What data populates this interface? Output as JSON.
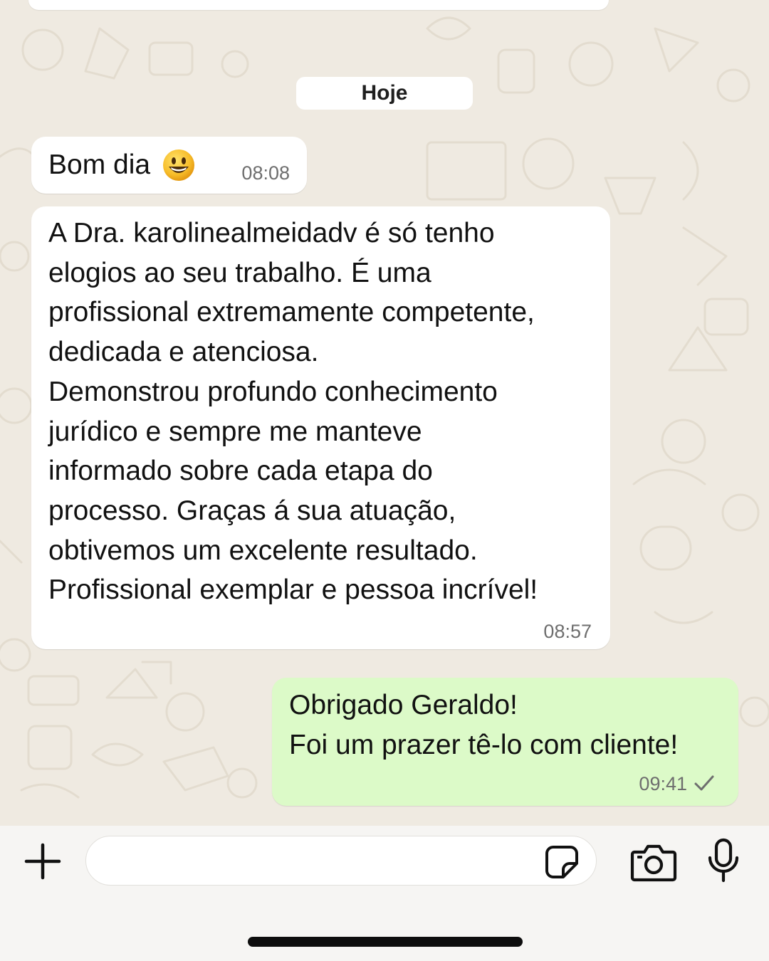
{
  "chat": {
    "date_separator": "Hoje",
    "messages": [
      {
        "direction": "incoming",
        "text": "Bom dia",
        "emoji": "smiling-face-emoji",
        "time": "08:08"
      },
      {
        "direction": "incoming",
        "text": "A Dra. karolinealmeidadv é só tenho\nelogios ao seu trabalho. É uma\nprofissional extremamente competente,\ndedicada e atenciosa.\nDemonstrou profundo conhecimento\njurídico e sempre me manteve\ninformado sobre cada etapa do\nprocesso. Graças á sua atuação,\nobtivemos um excelente resultado.\nProfissional exemplar e pessoa incrível!",
        "time": "08:57"
      },
      {
        "direction": "outgoing",
        "text": "Obrigado Geraldo!\nFoi um prazer tê-lo com cliente!",
        "time": "09:41",
        "status_icon": "single-check-icon"
      }
    ]
  },
  "input_bar": {
    "message_value": "",
    "icons": [
      "plus-icon",
      "sticker-icon",
      "camera-icon",
      "microphone-icon"
    ]
  },
  "colors": {
    "chat_background": "#efeae1",
    "incoming_bubble": "#ffffff",
    "outgoing_bubble": "#dcfac8",
    "timestamp": "#6e6e6e"
  }
}
